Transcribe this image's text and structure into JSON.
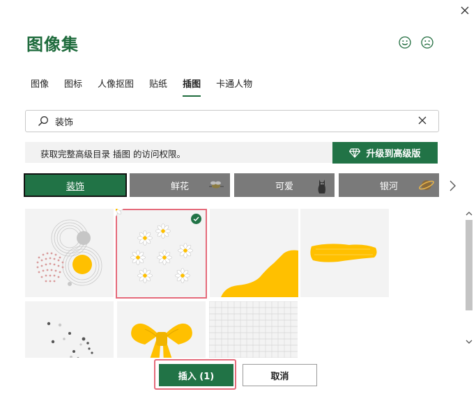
{
  "dialog": {
    "title": "图像集",
    "close_icon": "close-icon",
    "feedback": {
      "smile_icon": "smile-icon",
      "frown_icon": "frown-icon"
    }
  },
  "tabs": [
    {
      "label": "图像",
      "active": false
    },
    {
      "label": "图标",
      "active": false
    },
    {
      "label": "人像抠图",
      "active": false
    },
    {
      "label": "贴纸",
      "active": false
    },
    {
      "label": "插图",
      "active": true
    },
    {
      "label": "卡通人物",
      "active": false
    }
  ],
  "search": {
    "value": "装饰",
    "search_icon": "search-icon",
    "clear_icon": "clear-icon"
  },
  "banner": {
    "message": "获取完整高级目录 插图 的访问权限。",
    "upgrade_label": "升级到高级版",
    "upgrade_icon": "diamond-icon"
  },
  "categories": [
    {
      "label": "装饰",
      "selected": true
    },
    {
      "label": "鲜花",
      "selected": false
    },
    {
      "label": "可爱",
      "selected": false
    },
    {
      "label": "银河",
      "selected": false
    }
  ],
  "colors": {
    "accent": "#217346",
    "title_green": "#1e6b3c",
    "illustration_yellow": "#ffc000",
    "highlight_red": "#e56a7a",
    "tile_bg": "#f3f3f3"
  },
  "tiles": [
    {
      "name": "circles-illustration",
      "selected": false
    },
    {
      "name": "daisies-illustration",
      "selected": true
    },
    {
      "name": "yellow-wave-illustration",
      "selected": false
    },
    {
      "name": "yellow-brush-stroke-illustration",
      "selected": false
    },
    {
      "name": "scattered-dots-illustration",
      "selected": false
    },
    {
      "name": "yellow-bow-illustration",
      "selected": false
    },
    {
      "name": "grid-paper-illustration",
      "selected": false
    }
  ],
  "footer": {
    "insert_label": "插入 (1)",
    "cancel_label": "取消"
  }
}
